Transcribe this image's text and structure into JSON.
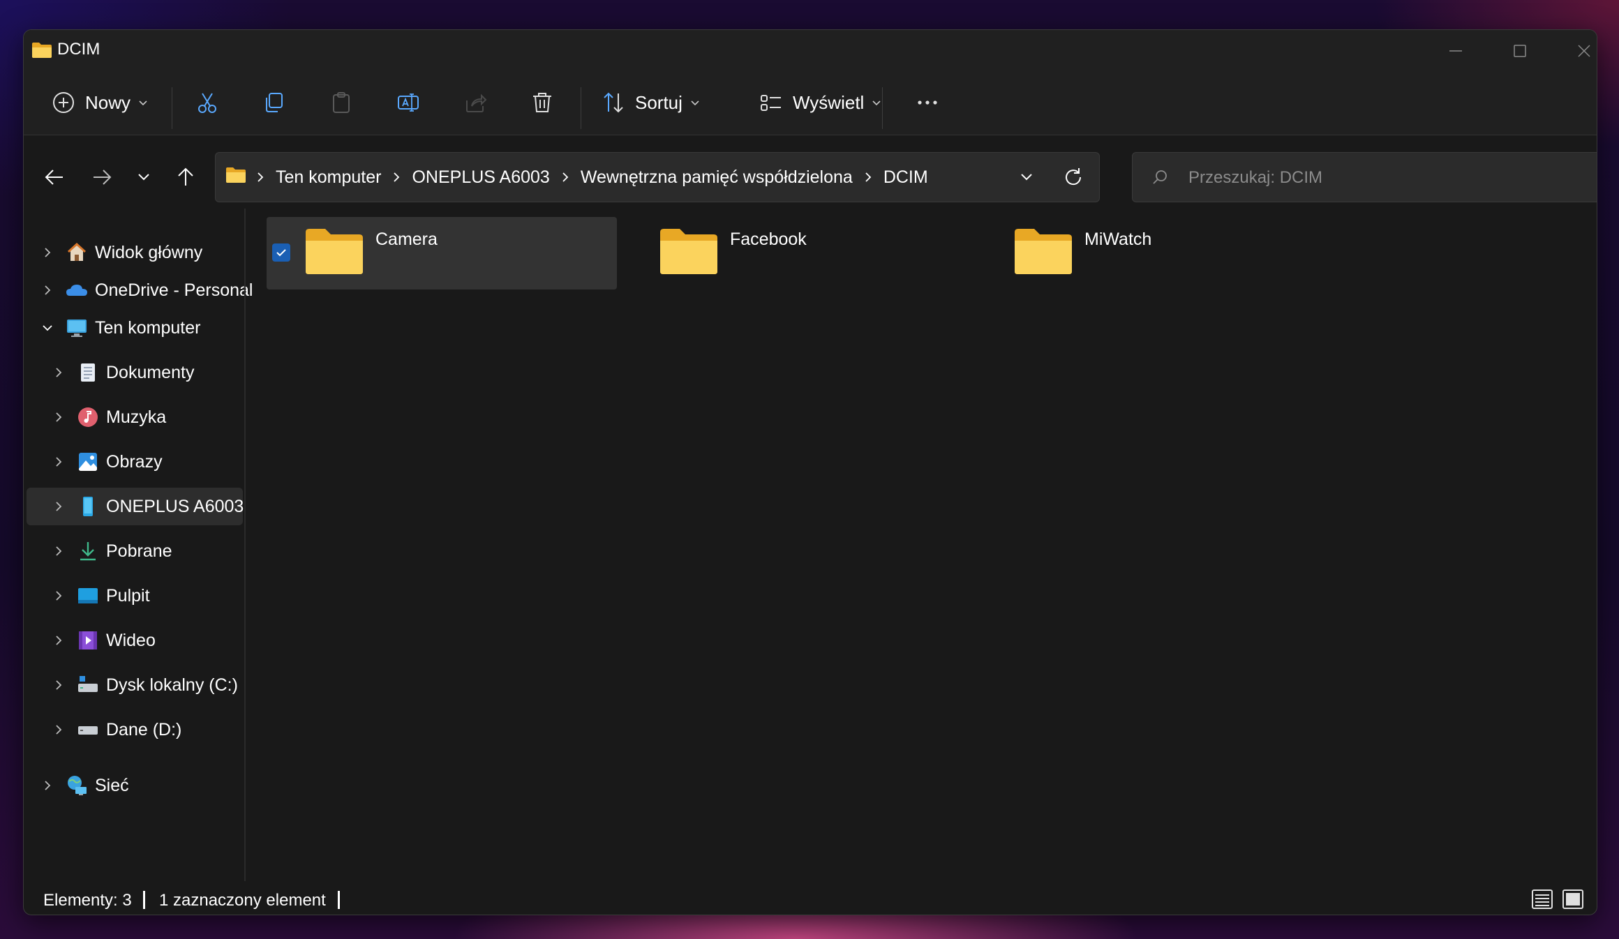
{
  "window": {
    "title": "DCIM"
  },
  "toolbar": {
    "new_label": "Nowy",
    "sort_label": "Sortuj",
    "view_label": "Wyświetl"
  },
  "address": {
    "crumbs": [
      "Ten komputer",
      "ONEPLUS A6003",
      "Wewnętrzna pamięć współdzielona",
      "DCIM"
    ]
  },
  "search": {
    "placeholder": "Przeszukaj: DCIM"
  },
  "sidebar": {
    "items": [
      {
        "label": "Widok główny",
        "icon": "home-icon"
      },
      {
        "label": "OneDrive - Personal",
        "icon": "onedrive-icon"
      },
      {
        "label": "Ten komputer",
        "icon": "computer-icon"
      },
      {
        "label": "Dokumenty",
        "icon": "documents-icon"
      },
      {
        "label": "Muzyka",
        "icon": "music-icon"
      },
      {
        "label": "Obrazy",
        "icon": "pictures-icon"
      },
      {
        "label": "ONEPLUS A6003",
        "icon": "phone-icon"
      },
      {
        "label": "Pobrane",
        "icon": "download-icon"
      },
      {
        "label": "Pulpit",
        "icon": "desktop-icon"
      },
      {
        "label": "Wideo",
        "icon": "video-icon"
      },
      {
        "label": "Dysk lokalny (C:)",
        "icon": "drive-c-icon"
      },
      {
        "label": "Dane (D:)",
        "icon": "drive-d-icon"
      },
      {
        "label": "Sieć",
        "icon": "network-icon"
      }
    ]
  },
  "content": {
    "folders": [
      {
        "name": "Camera",
        "selected": true
      },
      {
        "name": "Facebook",
        "selected": false
      },
      {
        "name": "MiWatch",
        "selected": false
      }
    ]
  },
  "status": {
    "count": "Elementy: 3",
    "selected": "1 zaznaczony element"
  },
  "colors": {
    "window_bg": "#191919",
    "chrome_bg": "#202020",
    "folder_yellow": "#f7c948",
    "accent": "#1a5fb4"
  }
}
